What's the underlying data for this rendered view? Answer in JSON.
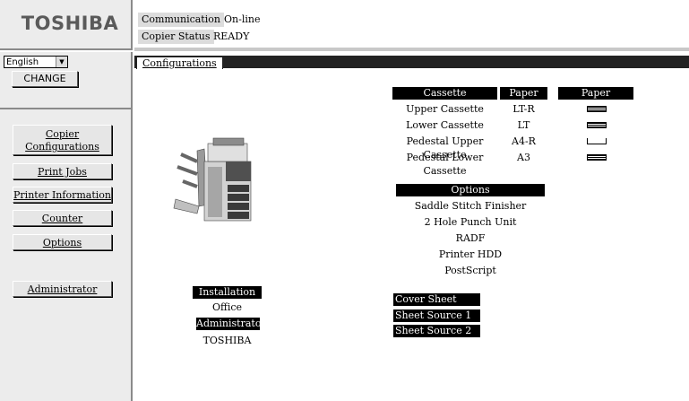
{
  "brand": {
    "logo": "TOSHIBA"
  },
  "language": {
    "selected": "English",
    "change_label": "CHANGE"
  },
  "nav": {
    "copier_configurations": [
      "Copier",
      "Configurations"
    ],
    "print_jobs": "Print Jobs",
    "printer_information": "Printer Information",
    "counter": "Counter",
    "options": "Options",
    "administrator": "Administrator"
  },
  "status": {
    "communication_label": "Communication",
    "communication_value": "On-line",
    "copier_status_label": "Copier Status",
    "copier_status_value": "READY"
  },
  "tabs": {
    "active": "Configurations"
  },
  "cassettes": {
    "headers": {
      "cassette": "Cassette",
      "paper_size": "Paper Size",
      "paper_remaining": "Paper Remaining"
    },
    "rows": [
      {
        "name": "Upper Cassette",
        "size": "LT-R",
        "remaining": "full"
      },
      {
        "name": "Lower Cassette",
        "size": "LT",
        "remaining": "full"
      },
      {
        "name": "Pedestal Upper Cassette",
        "size": "A4-R",
        "remaining": "empty"
      },
      {
        "name": "Pedestal Lower Cassette",
        "size": "A3",
        "remaining": "full"
      }
    ]
  },
  "options": {
    "header": "Options",
    "items": [
      "Saddle Stitch Finisher",
      "2 Hole Punch Unit",
      "RADF",
      "Printer HDD",
      "PostScript"
    ]
  },
  "site": {
    "installation_site_label": "Installation Site",
    "installation_site_value": "Office",
    "administrator_label": "Administrator",
    "administrator_value": "TOSHIBA"
  },
  "sheet_sources": [
    "Cover Sheet Source",
    "Sheet Source 1",
    "Sheet Source 2"
  ]
}
